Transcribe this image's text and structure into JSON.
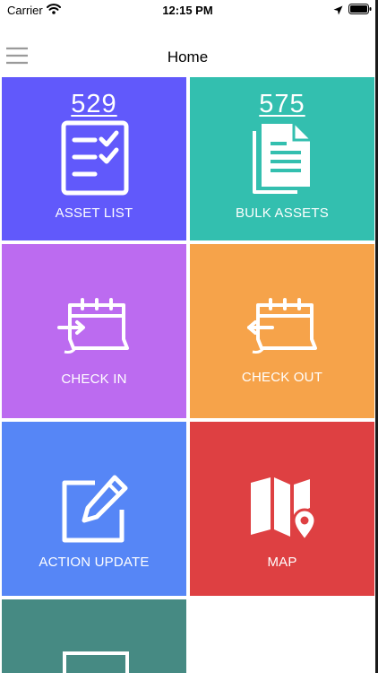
{
  "status_bar": {
    "carrier": "Carrier",
    "time": "12:15 PM"
  },
  "nav": {
    "title": "Home"
  },
  "tiles": [
    {
      "label": "ASSET LIST",
      "count": "529",
      "color": "#6159fb",
      "icon": "checklist-icon"
    },
    {
      "label": "BULK ASSETS",
      "count": "575",
      "color": "#33bfaf",
      "icon": "documents-icon"
    },
    {
      "label": "CHECK IN",
      "color": "#bc6bf0",
      "icon": "calendar-check-in-icon"
    },
    {
      "label": "CHECK OUT",
      "color": "#f6a34a",
      "icon": "calendar-check-out-icon"
    },
    {
      "label": "ACTION UPDATE",
      "color": "#5686f6",
      "icon": "edit-icon"
    },
    {
      "label": "MAP",
      "color": "#de4042",
      "icon": "map-pin-icon"
    },
    {
      "color": "#468a83",
      "icon": "monitor-icon"
    }
  ]
}
